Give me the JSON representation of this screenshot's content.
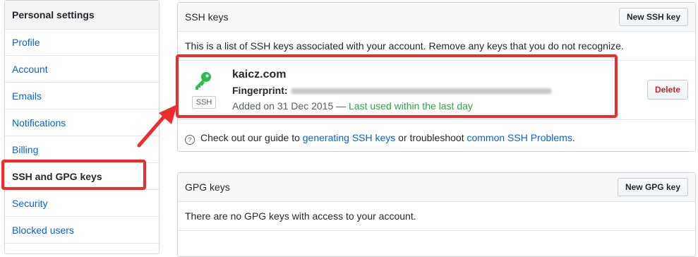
{
  "sidebar": {
    "header": "Personal settings",
    "items": [
      {
        "label": "Profile"
      },
      {
        "label": "Account"
      },
      {
        "label": "Emails"
      },
      {
        "label": "Notifications"
      },
      {
        "label": "Billing"
      },
      {
        "label": "SSH and GPG keys"
      },
      {
        "label": "Security"
      },
      {
        "label": "Blocked users"
      }
    ]
  },
  "ssh": {
    "title": "SSH keys",
    "new_button": "New SSH key",
    "description": "This is a list of SSH keys associated with your account. Remove any keys that you do not recognize.",
    "key": {
      "name": "kaicz.com",
      "fingerprint_label": "Fingerprint:",
      "type_label": "SSH",
      "added": "Added on 31 Dec 2015 — ",
      "last_used": "Last used within the last day",
      "delete_button": "Delete"
    },
    "guide": {
      "prefix": "Check out our guide to ",
      "link1": "generating SSH keys",
      "middle": " or troubleshoot ",
      "link2": "common SSH Problems",
      "suffix": "."
    }
  },
  "gpg": {
    "title": "GPG keys",
    "new_button": "New GPG key",
    "description": "There are no GPG keys with access to your account."
  },
  "colors": {
    "link": "#0366d6",
    "annotation": "#ef2b2b",
    "success": "#28a745",
    "danger": "#cb2431",
    "key_icon": "#2cbe4e"
  }
}
